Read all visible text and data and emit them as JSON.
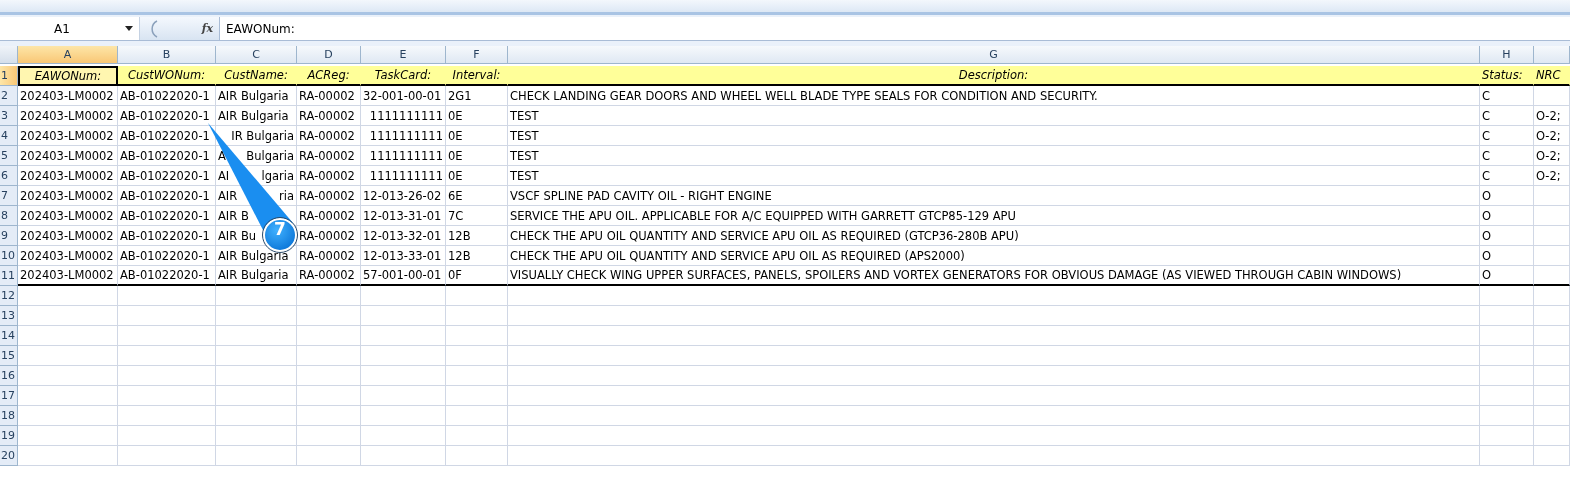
{
  "formula_bar": {
    "name_box": "A1",
    "fx": "fx",
    "formula": "EAWONum:"
  },
  "columns": [
    {
      "letter": "A",
      "selected": true
    },
    {
      "letter": "B",
      "selected": false
    },
    {
      "letter": "C",
      "selected": false
    },
    {
      "letter": "D",
      "selected": false
    },
    {
      "letter": "E",
      "selected": false
    },
    {
      "letter": "F",
      "selected": false
    },
    {
      "letter": "G",
      "selected": false
    },
    {
      "letter": "H",
      "selected": false
    },
    {
      "selected": false
    }
  ],
  "header_row": {
    "number": "1",
    "selected": true,
    "cells": [
      {
        "text": "EAWONum:",
        "selected": true
      },
      {
        "text": "CustWONum:",
        "selected": false
      },
      {
        "text": "CustName:",
        "selected": false
      },
      {
        "text": "ACReg:",
        "selected": false
      },
      {
        "text": "TaskCard:",
        "selected": false
      },
      {
        "text": "Interval:",
        "selected": false
      },
      {
        "text": "Description:",
        "selected": false
      },
      {
        "text": "Status:",
        "selected": false
      },
      {
        "text": "NRC",
        "selected": false
      }
    ]
  },
  "rows": [
    {
      "number": "2",
      "cells": [
        "202403-LM0002",
        "AB-01022020-1",
        "AIR Bulgaria",
        "RA-00002",
        "32-001-00-01",
        "2G1",
        "CHECK LANDING GEAR DOORS AND WHEEL WELL BLADE TYPE SEALS FOR CONDITION AND SECURITY.",
        "C",
        null
      ]
    },
    {
      "number": "3",
      "cells": [
        "202403-LM0002",
        "AB-01022020-1",
        "AIR Bulgaria",
        "RA-00002",
        {
          "number": "1111111111"
        },
        "0E",
        "TEST",
        "C",
        "O-2;"
      ]
    },
    {
      "number": "4",
      "cells": [
        "202403-LM0002",
        "AB-01022020-1",
        {
          "right": "IR Bulgaria"
        },
        "RA-00002",
        {
          "number": "1111111111"
        },
        "0E",
        "TEST",
        "C",
        "O-2;"
      ]
    },
    {
      "number": "5",
      "cells": [
        "202403-LM0002",
        "AB-01022020-1",
        {
          "left": "A",
          "right": "Bulgaria"
        },
        "RA-00002",
        {
          "number": "1111111111"
        },
        "0E",
        "TEST",
        "C",
        "O-2;"
      ]
    },
    {
      "number": "6",
      "cells": [
        "202403-LM0002",
        "AB-01022020-1",
        {
          "left": "AI",
          "right": "lgaria"
        },
        "RA-00002",
        {
          "number": "1111111111"
        },
        "0E",
        "TEST",
        "C",
        "O-2;"
      ]
    },
    {
      "number": "7",
      "cells": [
        "202403-LM0002",
        "AB-01022020-1",
        {
          "left": "AIR",
          "right": "ria"
        },
        "RA-00002",
        "12-013-26-02",
        "6E",
        "VSCF SPLINE PAD CAVITY OIL - RIGHT ENGINE",
        "O",
        null
      ]
    },
    {
      "number": "8",
      "cells": [
        "202403-LM0002",
        "AB-01022020-1",
        {
          "left": "AIR B"
        },
        "RA-00002",
        "12-013-31-01",
        "7C",
        "SERVICE THE APU OIL. APPLICABLE FOR A/C EQUIPPED WITH GARRETT GTCP85-129 APU",
        "O",
        null
      ]
    },
    {
      "number": "9",
      "cells": [
        "202403-LM0002",
        "AB-01022020-1",
        {
          "left": "AIR Bu"
        },
        "RA-00002",
        "12-013-32-01",
        "12B",
        "CHECK THE APU OIL QUANTITY AND SERVICE APU OIL AS REQUIRED (GTCP36-280B APU)",
        "O",
        null
      ]
    },
    {
      "number": "10",
      "cells": [
        "202403-LM0002",
        "AB-01022020-1",
        "AIR Bulgaria",
        "RA-00002",
        "12-013-33-01",
        "12B",
        "CHECK THE APU OIL QUANTITY AND SERVICE APU OIL AS REQUIRED (APS2000)",
        "O",
        null
      ]
    },
    {
      "number": "11",
      "cells": [
        "202403-LM0002",
        "AB-01022020-1",
        "AIR Bulgaria",
        "RA-00002",
        "57-001-00-01",
        "0F",
        "VISUALLY CHECK WING UPPER SURFACES, PANELS, SPOILERS AND VORTEX GENERATORS FOR OBVIOUS DAMAGE (AS VIEWED THROUGH CABIN WINDOWS)",
        "O",
        null
      ]
    }
  ],
  "empty_rows": [
    "12",
    "13",
    "14",
    "15",
    "16",
    "17",
    "18",
    "19",
    "20"
  ],
  "callout": {
    "number": "7"
  }
}
